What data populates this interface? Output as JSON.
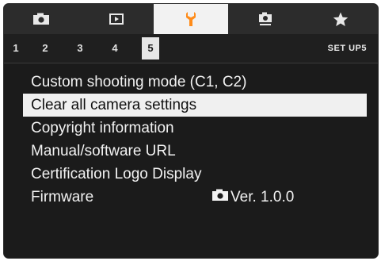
{
  "tabs": [
    {
      "icon": "camera-icon",
      "active": false
    },
    {
      "icon": "playback-icon",
      "active": false
    },
    {
      "icon": "wrench-icon",
      "active": true
    },
    {
      "icon": "camera-custom-icon",
      "active": false
    },
    {
      "icon": "star-icon",
      "active": false
    }
  ],
  "pages": [
    "1",
    "2",
    "3",
    "4",
    "5"
  ],
  "active_page": "5",
  "menu_name": "SET UP5",
  "menu": {
    "items": [
      {
        "label": "Custom shooting mode (C1, C2)"
      },
      {
        "label": "Clear all camera settings",
        "selected": true
      },
      {
        "label": "Copyright information"
      },
      {
        "label": "Manual/software URL"
      },
      {
        "label": "Certification Logo Display"
      },
      {
        "label": "Firmware",
        "value": "Ver. 1.0.0",
        "value_icon": "camera-icon"
      }
    ]
  },
  "colors": {
    "background": "#1b1b1b",
    "active_tab": "#f2f2f2",
    "selected_row": "#f0f0f0",
    "text": "#f2f2f2"
  }
}
